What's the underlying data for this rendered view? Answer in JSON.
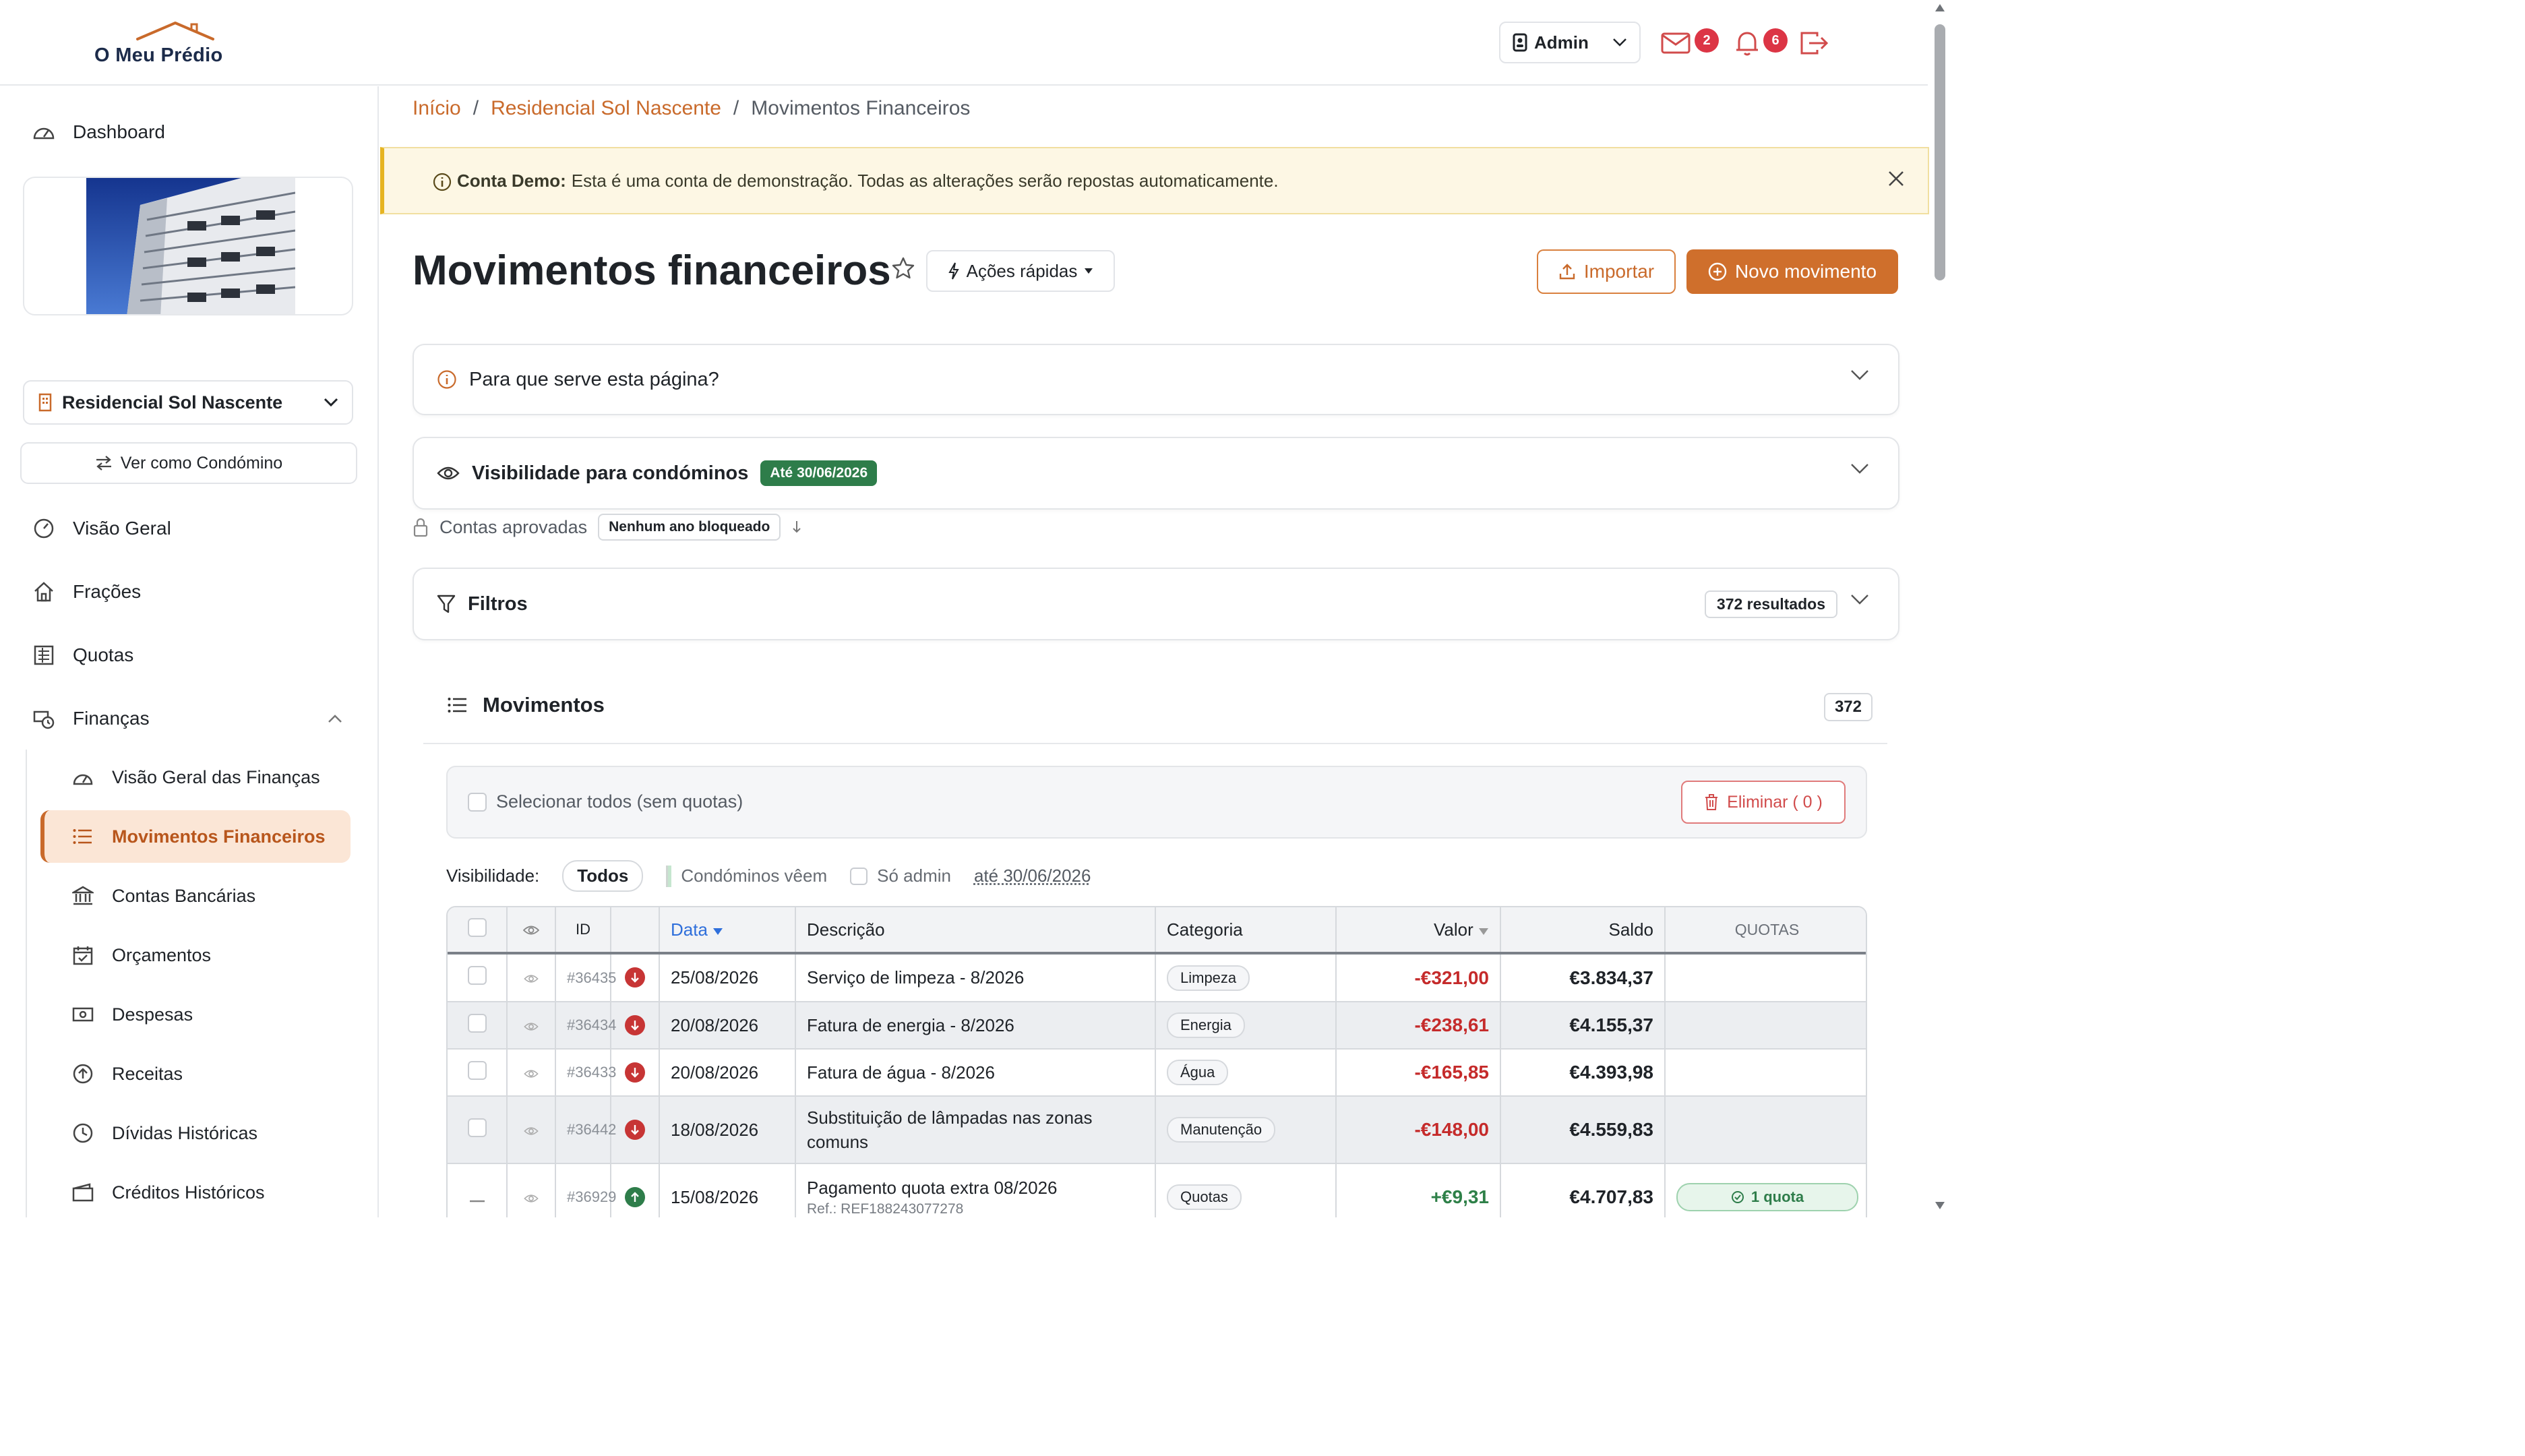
{
  "app": {
    "logo_text": "O Meu Prédio"
  },
  "topbar": {
    "user_label": "Admin",
    "mail_badge": "2",
    "notif_badge": "6"
  },
  "sidebar": {
    "dashboard": "Dashboard",
    "condo_selected": "Residencial Sol Nascente",
    "view_as": "Ver como Condómino",
    "items": [
      {
        "label": "Visão Geral",
        "icon": "gauge-icon"
      },
      {
        "label": "Frações",
        "icon": "home-icon"
      },
      {
        "label": "Quotas",
        "icon": "ledger-icon"
      },
      {
        "label": "Finanças",
        "icon": "money-clock-icon"
      }
    ],
    "finance_sub": [
      {
        "label": "Visão Geral das Finanças"
      },
      {
        "label": "Movimentos Financeiros"
      },
      {
        "label": "Contas Bancárias"
      },
      {
        "label": "Orçamentos"
      },
      {
        "label": "Despesas"
      },
      {
        "label": "Receitas"
      },
      {
        "label": "Dívidas Históricas"
      },
      {
        "label": "Créditos Históricos"
      }
    ]
  },
  "breadcrumb": {
    "home": "Início",
    "condo": "Residencial Sol Nascente",
    "current": "Movimentos Financeiros",
    "sep": "/"
  },
  "banner": {
    "strong": "Conta Demo:",
    "text": "Esta é uma conta de demonstração. Todas as alterações serão repostas automaticamente."
  },
  "page": {
    "title": "Movimentos financeiros",
    "quick_actions": "Ações rápidas",
    "import": "Importar",
    "new_movement": "Novo movimento"
  },
  "panels": {
    "help": "Para que serve esta página?",
    "visibility": "Visibilidade para condóminos",
    "visibility_badge": "Até 30/06/2026",
    "approved": "Contas aprovadas",
    "approved_chip": "Nenhum ano bloqueado",
    "filters": "Filtros",
    "results": "372 resultados"
  },
  "movements": {
    "title": "Movimentos",
    "count": "372",
    "select_all": "Selecionar todos (sem quotas)",
    "delete": "Eliminar ( 0 )",
    "visibility_label": "Visibilidade:",
    "vis_all": "Todos",
    "vis_condos": "Condóminos vêem",
    "vis_admin": "Só admin",
    "vis_until": "até 30/06/2026"
  },
  "table": {
    "columns": [
      "ID",
      "Data",
      "Descrição",
      "Categoria",
      "Valor",
      "Saldo",
      "QUOTAS"
    ],
    "rows": [
      {
        "id": "#36435",
        "dir": "out",
        "date": "25/08/2026",
        "desc": "Serviço de limpeza - 8/2026",
        "ref": "",
        "cat": "Limpeza",
        "value": "-€321,00",
        "balance": "€3.834,37",
        "quota": ""
      },
      {
        "id": "#36434",
        "dir": "out",
        "date": "20/08/2026",
        "desc": "Fatura de energia - 8/2026",
        "ref": "",
        "cat": "Energia",
        "value": "-€238,61",
        "balance": "€4.155,37",
        "quota": ""
      },
      {
        "id": "#36433",
        "dir": "out",
        "date": "20/08/2026",
        "desc": "Fatura de água - 8/2026",
        "ref": "",
        "cat": "Água",
        "value": "-€165,85",
        "balance": "€4.393,98",
        "quota": ""
      },
      {
        "id": "#36442",
        "dir": "out",
        "date": "18/08/2026",
        "desc": "Substituição de lâmpadas nas zonas comuns",
        "ref": "",
        "cat": "Manutenção",
        "value": "-€148,00",
        "balance": "€4.559,83",
        "quota": ""
      },
      {
        "id": "#36929",
        "dir": "in",
        "date": "15/08/2026",
        "desc": "Pagamento quota extra 08/2026",
        "ref": "Ref.: REF188243077278",
        "cat": "Quotas",
        "value": "+€9,31",
        "balance": "€4.707,83",
        "quota": "1 quota"
      }
    ]
  },
  "colors": {
    "brand": "#cf6f2c",
    "negative": "#c52b2b",
    "positive": "#2e8048",
    "badge_red": "#dc3545"
  }
}
